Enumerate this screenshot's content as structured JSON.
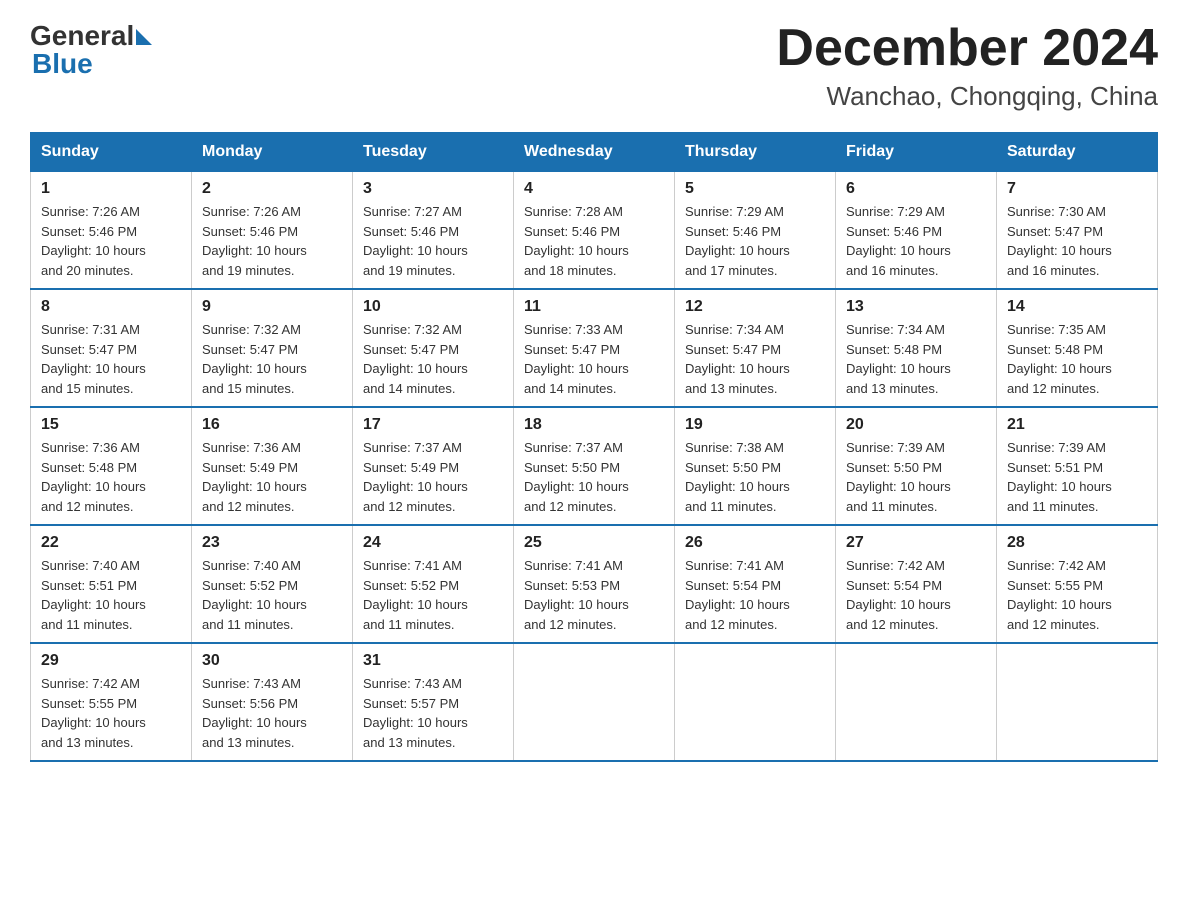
{
  "logo": {
    "general": "General",
    "blue": "Blue"
  },
  "title": "December 2024",
  "subtitle": "Wanchao, Chongqing, China",
  "headers": [
    "Sunday",
    "Monday",
    "Tuesday",
    "Wednesday",
    "Thursday",
    "Friday",
    "Saturday"
  ],
  "weeks": [
    [
      {
        "day": "1",
        "sunrise": "7:26 AM",
        "sunset": "5:46 PM",
        "daylight": "10 hours and 20 minutes."
      },
      {
        "day": "2",
        "sunrise": "7:26 AM",
        "sunset": "5:46 PM",
        "daylight": "10 hours and 19 minutes."
      },
      {
        "day": "3",
        "sunrise": "7:27 AM",
        "sunset": "5:46 PM",
        "daylight": "10 hours and 19 minutes."
      },
      {
        "day": "4",
        "sunrise": "7:28 AM",
        "sunset": "5:46 PM",
        "daylight": "10 hours and 18 minutes."
      },
      {
        "day": "5",
        "sunrise": "7:29 AM",
        "sunset": "5:46 PM",
        "daylight": "10 hours and 17 minutes."
      },
      {
        "day": "6",
        "sunrise": "7:29 AM",
        "sunset": "5:46 PM",
        "daylight": "10 hours and 16 minutes."
      },
      {
        "day": "7",
        "sunrise": "7:30 AM",
        "sunset": "5:47 PM",
        "daylight": "10 hours and 16 minutes."
      }
    ],
    [
      {
        "day": "8",
        "sunrise": "7:31 AM",
        "sunset": "5:47 PM",
        "daylight": "10 hours and 15 minutes."
      },
      {
        "day": "9",
        "sunrise": "7:32 AM",
        "sunset": "5:47 PM",
        "daylight": "10 hours and 15 minutes."
      },
      {
        "day": "10",
        "sunrise": "7:32 AM",
        "sunset": "5:47 PM",
        "daylight": "10 hours and 14 minutes."
      },
      {
        "day": "11",
        "sunrise": "7:33 AM",
        "sunset": "5:47 PM",
        "daylight": "10 hours and 14 minutes."
      },
      {
        "day": "12",
        "sunrise": "7:34 AM",
        "sunset": "5:47 PM",
        "daylight": "10 hours and 13 minutes."
      },
      {
        "day": "13",
        "sunrise": "7:34 AM",
        "sunset": "5:48 PM",
        "daylight": "10 hours and 13 minutes."
      },
      {
        "day": "14",
        "sunrise": "7:35 AM",
        "sunset": "5:48 PM",
        "daylight": "10 hours and 12 minutes."
      }
    ],
    [
      {
        "day": "15",
        "sunrise": "7:36 AM",
        "sunset": "5:48 PM",
        "daylight": "10 hours and 12 minutes."
      },
      {
        "day": "16",
        "sunrise": "7:36 AM",
        "sunset": "5:49 PM",
        "daylight": "10 hours and 12 minutes."
      },
      {
        "day": "17",
        "sunrise": "7:37 AM",
        "sunset": "5:49 PM",
        "daylight": "10 hours and 12 minutes."
      },
      {
        "day": "18",
        "sunrise": "7:37 AM",
        "sunset": "5:50 PM",
        "daylight": "10 hours and 12 minutes."
      },
      {
        "day": "19",
        "sunrise": "7:38 AM",
        "sunset": "5:50 PM",
        "daylight": "10 hours and 11 minutes."
      },
      {
        "day": "20",
        "sunrise": "7:39 AM",
        "sunset": "5:50 PM",
        "daylight": "10 hours and 11 minutes."
      },
      {
        "day": "21",
        "sunrise": "7:39 AM",
        "sunset": "5:51 PM",
        "daylight": "10 hours and 11 minutes."
      }
    ],
    [
      {
        "day": "22",
        "sunrise": "7:40 AM",
        "sunset": "5:51 PM",
        "daylight": "10 hours and 11 minutes."
      },
      {
        "day": "23",
        "sunrise": "7:40 AM",
        "sunset": "5:52 PM",
        "daylight": "10 hours and 11 minutes."
      },
      {
        "day": "24",
        "sunrise": "7:41 AM",
        "sunset": "5:52 PM",
        "daylight": "10 hours and 11 minutes."
      },
      {
        "day": "25",
        "sunrise": "7:41 AM",
        "sunset": "5:53 PM",
        "daylight": "10 hours and 12 minutes."
      },
      {
        "day": "26",
        "sunrise": "7:41 AM",
        "sunset": "5:54 PM",
        "daylight": "10 hours and 12 minutes."
      },
      {
        "day": "27",
        "sunrise": "7:42 AM",
        "sunset": "5:54 PM",
        "daylight": "10 hours and 12 minutes."
      },
      {
        "day": "28",
        "sunrise": "7:42 AM",
        "sunset": "5:55 PM",
        "daylight": "10 hours and 12 minutes."
      }
    ],
    [
      {
        "day": "29",
        "sunrise": "7:42 AM",
        "sunset": "5:55 PM",
        "daylight": "10 hours and 13 minutes."
      },
      {
        "day": "30",
        "sunrise": "7:43 AM",
        "sunset": "5:56 PM",
        "daylight": "10 hours and 13 minutes."
      },
      {
        "day": "31",
        "sunrise": "7:43 AM",
        "sunset": "5:57 PM",
        "daylight": "10 hours and 13 minutes."
      },
      null,
      null,
      null,
      null
    ]
  ],
  "labels": {
    "sunrise": "Sunrise:",
    "sunset": "Sunset:",
    "daylight": "Daylight:"
  }
}
